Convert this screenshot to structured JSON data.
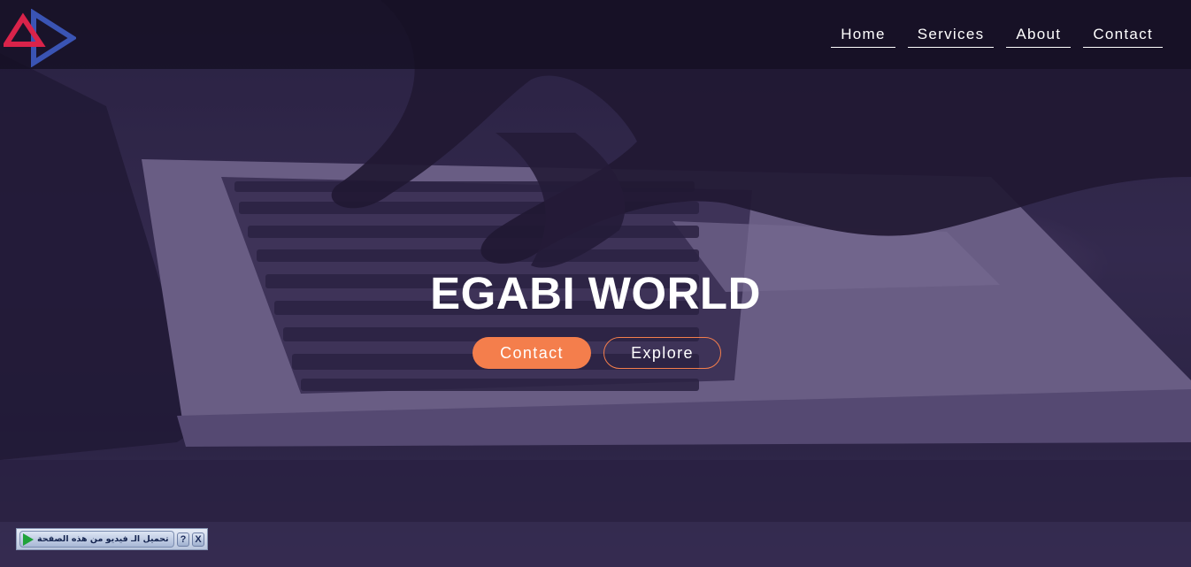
{
  "brand": {
    "logo_icon": "triangle-play-logo",
    "colors": {
      "red": "#d9234a",
      "blue": "#3a54b4"
    }
  },
  "nav": {
    "items": [
      {
        "label": "Home"
      },
      {
        "label": "Services"
      },
      {
        "label": "About"
      },
      {
        "label": "Contact"
      }
    ]
  },
  "hero": {
    "title": "EGABI WORLD",
    "primary_button": "Contact",
    "secondary_button": "Explore",
    "accent_color": "#f47e4c"
  },
  "video_toolbar": {
    "label": "تحميل الـ فيديو من هذه الصفحة",
    "help": "?",
    "close": "X",
    "play_icon": "play-icon"
  }
}
